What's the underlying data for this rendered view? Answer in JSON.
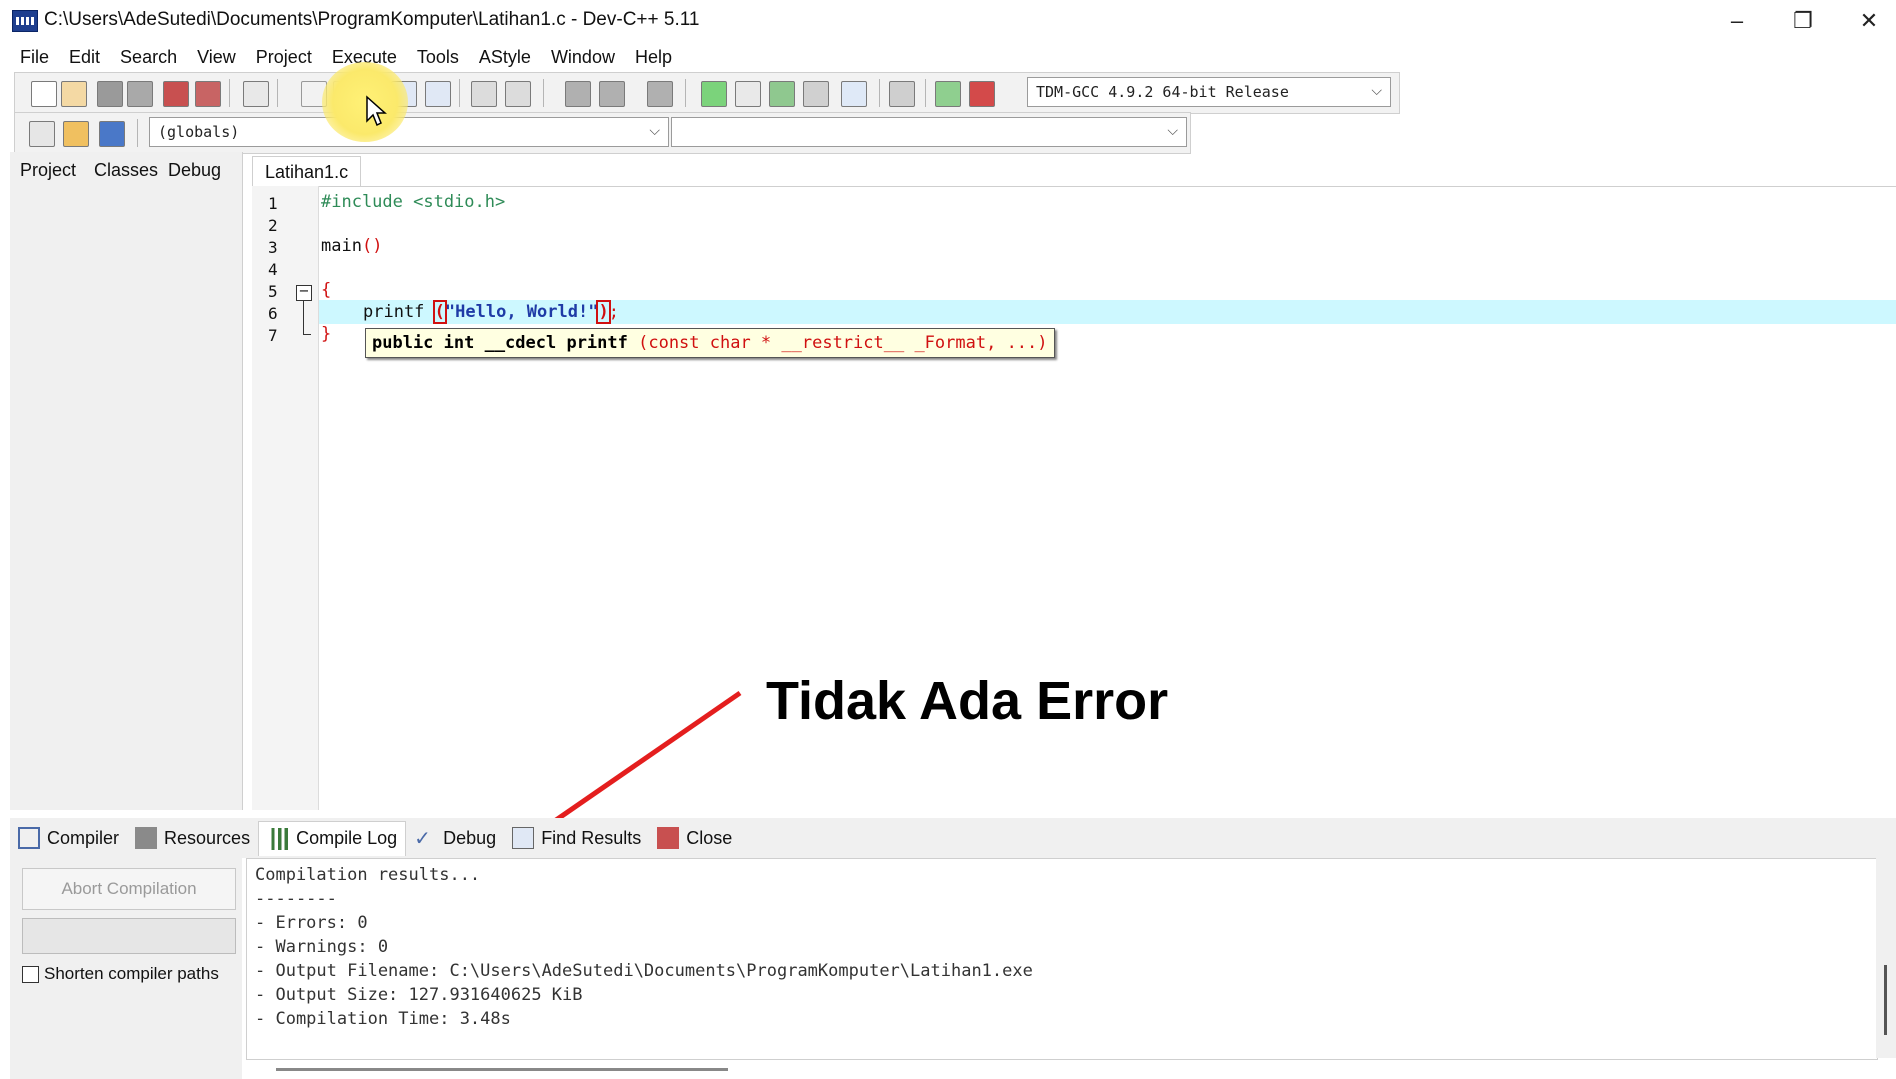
{
  "window": {
    "title": "C:\\Users\\AdeSutedi\\Documents\\ProgramKomputer\\Latihan1.c - Dev-C++ 5.11",
    "minimize": "–",
    "restore": "❐",
    "close": "✕"
  },
  "menu": [
    "File",
    "Edit",
    "Search",
    "View",
    "Project",
    "Execute",
    "Tools",
    "AStyle",
    "Window",
    "Help"
  ],
  "toolbar": {
    "compiler_select": "TDM-GCC 4.9.2 64-bit Release",
    "scope_select": "(globals)",
    "member_select": ""
  },
  "left_panel": {
    "tabs": [
      "Project",
      "Classes",
      "Debug"
    ]
  },
  "editor": {
    "tab": "Latihan1.c",
    "line_numbers": [
      "1",
      "2",
      "3",
      "4",
      "5",
      "6",
      "7"
    ],
    "lines": {
      "l1": "#include <stdio.h>",
      "l3_name": "main",
      "l3_parens": "()",
      "l5": "{",
      "l6_func": "printf ",
      "l6_open": "(",
      "l6_string": "\"Hello, World!\"",
      "l6_close": ")",
      "l6_semi": ";",
      "l7": "}"
    },
    "tooltip": {
      "prefix": "public int __cdecl printf ",
      "params": "(const char * __restrict__ _Format, ...)"
    },
    "colors": {
      "preprocessor": "#2e8b57",
      "string": "#1f3aa6",
      "symbol": "#d01010",
      "highlight_line": "#cdf8ff"
    }
  },
  "annotation": {
    "text": "Tidak Ada Error",
    "arrow_color": "#e41e1e"
  },
  "bottom_panel": {
    "tabs": [
      "Compiler",
      "Resources",
      "Compile Log",
      "Debug",
      "Find Results",
      "Close"
    ],
    "active_tab": "Compile Log",
    "abort_button": "Abort Compilation",
    "shorten_paths": "Shorten compiler paths",
    "shorten_paths_checked": false,
    "log": [
      "Compilation results...",
      "--------",
      "- Errors: 0",
      "- Warnings: 0",
      "- Output Filename: C:\\Users\\AdeSutedi\\Documents\\ProgramKomputer\\Latihan1.exe",
      "- Output Size: 127.931640625 KiB",
      "- Compilation Time: 3.48s"
    ]
  }
}
